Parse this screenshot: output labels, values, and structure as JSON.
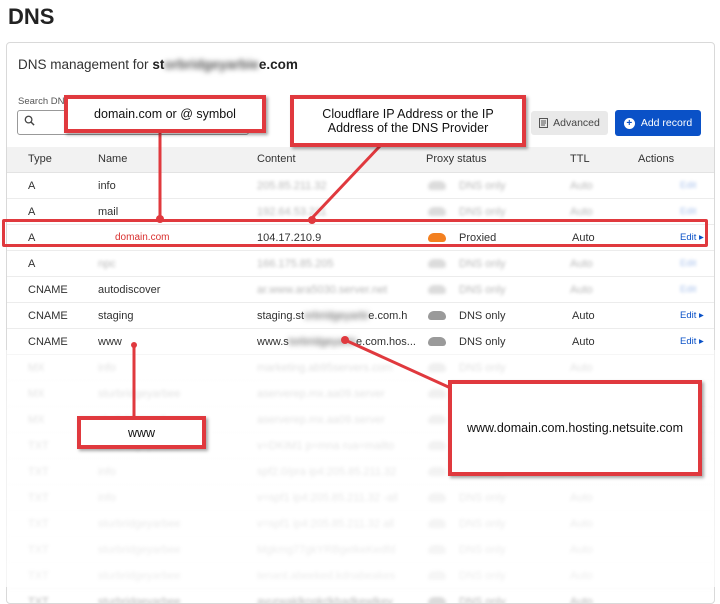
{
  "page_title": "DNS",
  "mgmt": {
    "prefix": "DNS management for ",
    "domain_blur": "st",
    "domain_hidden": "orbridgeyarbie",
    "domain_suffix": "e.com"
  },
  "search": {
    "label": "Search DNS",
    "icon": "search-icon"
  },
  "buttons": {
    "advanced": "Advanced",
    "add_record": "Add record"
  },
  "columns": [
    "Type",
    "Name",
    "Content",
    "Proxy status",
    "TTL",
    "Actions"
  ],
  "rows": [
    {
      "type": "A",
      "name": "info",
      "content": "205.85.211.32",
      "proxy": "DNS only",
      "ttl": "Auto",
      "edit": "Edit",
      "blur_content": true
    },
    {
      "type": "A",
      "name": "mail",
      "content": "192.64.53.211",
      "proxy": "DNS only",
      "ttl": "Auto",
      "edit": "Edit",
      "blur_content": true
    },
    {
      "type": "A",
      "name": "domain.com",
      "content": "104.17.210.9",
      "proxy": "Proxied",
      "ttl": "Auto",
      "edit": "Edit",
      "highlight": true
    },
    {
      "type": "A",
      "name": "npc",
      "content": "166.175.85.205",
      "proxy": "DNS only",
      "ttl": "Auto",
      "edit": "Edit",
      "blur_content": true
    },
    {
      "type": "CNAME",
      "name": "autodiscover",
      "content": "ar.www.ara5030.server.net",
      "proxy": "DNS only",
      "ttl": "Auto",
      "edit": "Edit",
      "blur_content": true
    },
    {
      "type": "CNAME",
      "name": "staging",
      "content": "staging.st",
      "content_hidden": "orbridgeyarbi",
      "content_suffix": "e.com.h",
      "proxy": "DNS only",
      "ttl": "Auto",
      "edit": "Edit"
    },
    {
      "type": "CNAME",
      "name": "www",
      "content": "www.s",
      "content_hidden": "torbridgeyarbi",
      "content_suffix": "e.com.hos...",
      "proxy": "DNS only",
      "ttl": "Auto",
      "edit": "Edit"
    }
  ],
  "faded_rows": [
    {
      "type": "MX",
      "name": "info",
      "content": "marketing.ab95servers.com",
      "proxy": "DNS only",
      "ttl": "Auto"
    },
    {
      "type": "MX",
      "name": "sturbridgeyarbee",
      "content": "aserverep.mx.aa09.server",
      "proxy": "DNS only",
      "ttl": "Auto"
    },
    {
      "type": "MX",
      "name": "sturbridgeyarbee",
      "content": "aserverep.mx.aa09.server",
      "proxy": "DNS only",
      "ttl": "Auto"
    },
    {
      "type": "TXT",
      "name": "sturbridgeyarbee",
      "content": "v=DKIM1 p=mna rua=mailto",
      "proxy": "DNS only",
      "ttl": "Auto"
    },
    {
      "type": "TXT",
      "name": "info",
      "content": "spf2.0/pra ip4:205.85.211.32",
      "proxy": "DNS only",
      "ttl": "Auto"
    },
    {
      "type": "TXT",
      "name": "info",
      "content": "v=spf1 ip4:205.85.211.32 -all",
      "proxy": "DNS only",
      "ttl": "Auto"
    },
    {
      "type": "TXT",
      "name": "sturbridgeyarbee",
      "content": "v=spf1 ip4:205.85.211.32 all",
      "proxy": "DNS only",
      "ttl": "Auto"
    },
    {
      "type": "TXT",
      "name": "sturbridgeyarbee",
      "content": "Mgkmg77gkYRBgetkeKedfd",
      "proxy": "DNS only",
      "ttl": "Auto"
    },
    {
      "type": "TXT",
      "name": "sturbridgeyarbee",
      "content": "tenant.abeeked.kdnabeakes",
      "proxy": "DNS only",
      "ttl": "Auto"
    },
    {
      "type": "TXT",
      "name": "sturbridgeyarbee",
      "content": "ayurwaklkngkrlkbadkewlkey",
      "proxy": "DNS only",
      "ttl": "Auto"
    }
  ],
  "annotations": {
    "domain": "domain.com or @ symbol",
    "cloudflare": "Cloudflare IP Address or the IP Address of the DNS Provider",
    "www": "www",
    "www_target": "www.domain.com.hosting.netsuite.com"
  },
  "colors": {
    "accent": "#0a51c7",
    "annotation": "#e0393e",
    "proxied": "#f38020"
  }
}
